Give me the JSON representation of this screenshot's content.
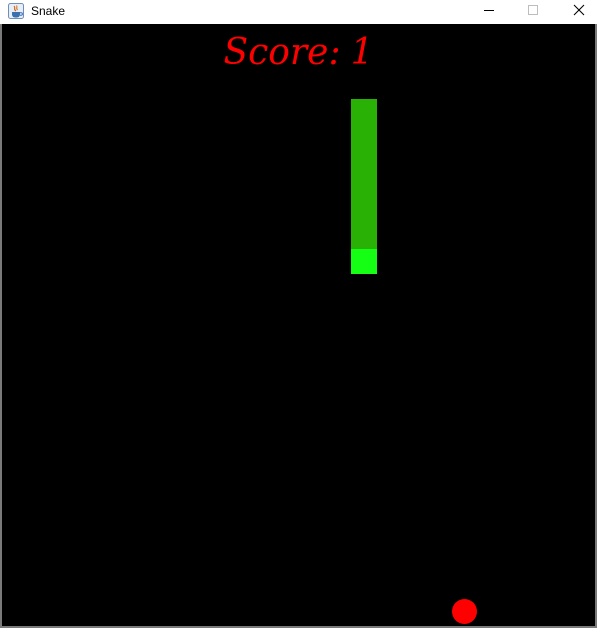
{
  "window": {
    "title": "Snake",
    "icon": "java-icon"
  },
  "controls": {
    "minimize_icon": "minimize-icon",
    "maximize_icon": "maximize-icon",
    "close_icon": "close-icon"
  },
  "game": {
    "score_label": "Score:",
    "score_value": "1",
    "snake_body_color": "#2ab106",
    "snake_head_color": "#15ff15",
    "food_color": "#ff0000",
    "background_color": "#000000"
  }
}
